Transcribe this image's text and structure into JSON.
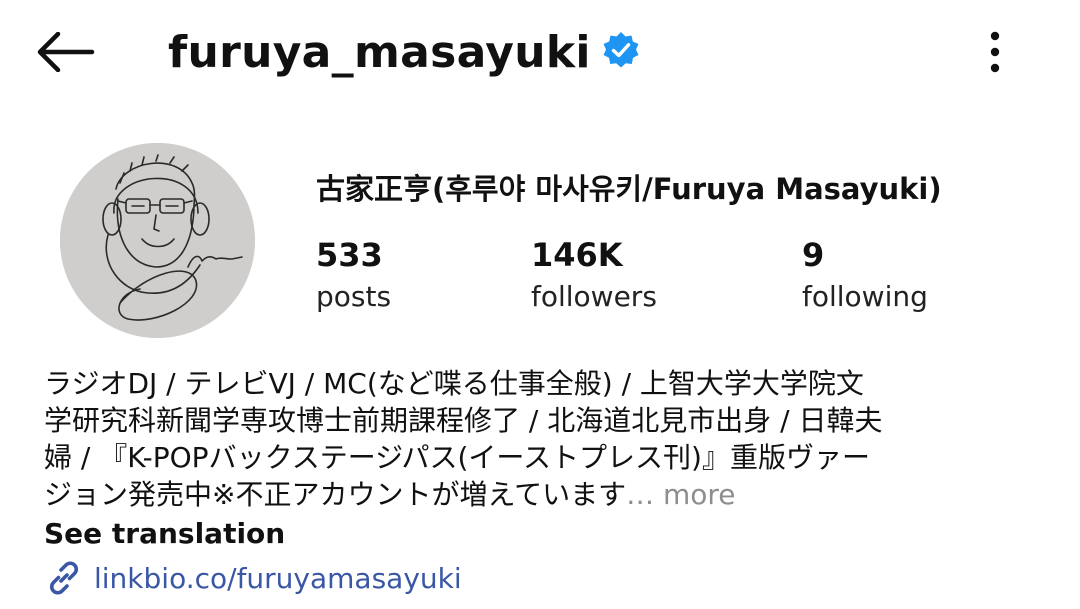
{
  "header": {
    "username": "furuya_masayuki",
    "verified": true,
    "accent_color": "#1e95f2"
  },
  "profile": {
    "full_name": "古家正亨(후루야 마사유키/Furuya Masayuki)",
    "stats": {
      "posts": {
        "value": "533",
        "label": "posts"
      },
      "followers": {
        "value": "146K",
        "label": "followers"
      },
      "following": {
        "value": "9",
        "label": "following"
      }
    }
  },
  "bio": {
    "lines": [
      "ラジオDJ / テレビVJ / MC(など喋る仕事全般) / 上智大学大学院文",
      "学研究科新聞学専攻博士前期課程修了 / 北海道北見市出身 / 日韓夫",
      "婦 / 『K-POPバックステージパス(イーストプレス刊)』重版ヴァー",
      "ジョン発売中※不正アカウントが増えています"
    ],
    "ellipsis": "…",
    "more_label": "more",
    "see_translation": "See translation"
  },
  "link": {
    "text": "linkbio.co/furuyamasayuki",
    "color": "#3a57a6"
  },
  "icons": {
    "back": "back-arrow-icon",
    "verified": "verified-badge-icon",
    "more": "more-vertical-icon",
    "link": "link-chain-icon"
  }
}
